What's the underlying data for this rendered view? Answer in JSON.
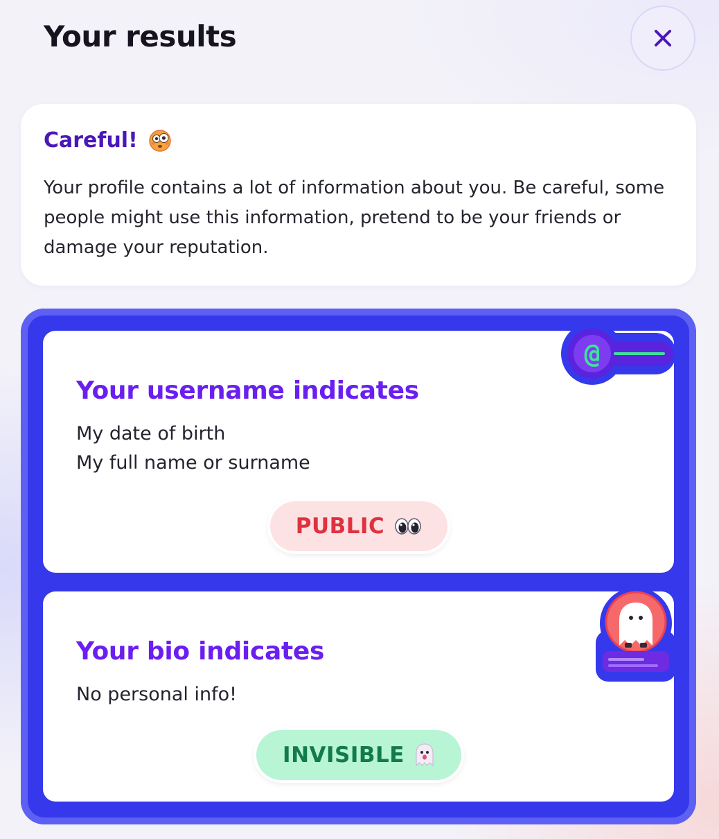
{
  "header": {
    "title": "Your results",
    "close_icon": "close-icon"
  },
  "warning": {
    "title": "Careful!",
    "emoji_icon": "flushed-face-icon",
    "body": "Your profile contains a lot of information about you. Be careful, some people might use this information, pretend to be your friends or damage your reputation."
  },
  "results": [
    {
      "heading": "Your username indicates",
      "items": [
        "My date of birth",
        "My full name or surname"
      ],
      "status": "PUBLIC",
      "status_icon": "eyes-icon",
      "badge_icon": "at-sign-icon",
      "status_color": "#e0313f",
      "status_bg": "#fde2e4"
    },
    {
      "heading": "Your bio indicates",
      "items": [
        "No personal info!"
      ],
      "status": "INVISIBLE",
      "status_icon": "ghost-icon",
      "badge_icon": "ghost-profile-icon",
      "status_color": "#137a4c",
      "status_bg": "#b7f5d4"
    }
  ],
  "colors": {
    "accent_purple": "#6a1ff0",
    "panel_blue": "#3638ec",
    "warning_title": "#4a17b8"
  }
}
